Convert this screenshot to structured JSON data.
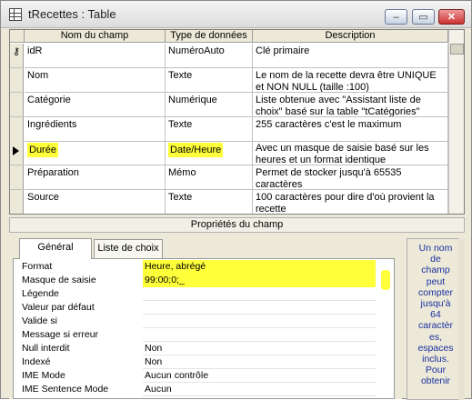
{
  "window": {
    "title": "tRecettes : Table",
    "min_label": "–",
    "max_label": "▭",
    "close_label": "✕"
  },
  "grid": {
    "headers": [
      "Nom du champ",
      "Type de données",
      "Description"
    ],
    "rows": [
      {
        "name": "idR",
        "type": "NuméroAuto",
        "desc": "Clé primaire",
        "key": true,
        "current": false,
        "highlight": false
      },
      {
        "name": "Nom",
        "type": "Texte",
        "desc": "Le nom de la recette devra être UNIQUE et NON NULL (taille :100)",
        "key": false,
        "current": false,
        "highlight": false
      },
      {
        "name": "Catégorie",
        "type": "Numérique",
        "desc": "Liste obtenue avec \"Assistant liste de choix\" basé sur la table \"tCatégories\"",
        "key": false,
        "current": false,
        "highlight": false
      },
      {
        "name": "Ingrédients",
        "type": "Texte",
        "desc": "255 caractères c'est le maximum",
        "key": false,
        "current": false,
        "highlight": false
      },
      {
        "name": "Durée",
        "type": "Date/Heure",
        "desc": "Avec un masque de saisie basé sur les heures et un format identique",
        "key": false,
        "current": true,
        "highlight": true
      },
      {
        "name": "Préparation",
        "type": "Mémo",
        "desc": "Permet de stocker jusqu'à 65535 caractères",
        "key": false,
        "current": false,
        "highlight": false
      },
      {
        "name": "Source",
        "type": "Texte",
        "desc": "100 caractères pour dire d'où provient la recette",
        "key": false,
        "current": false,
        "highlight": false
      }
    ]
  },
  "properties_bar": "Propriétés du champ",
  "tabs": [
    "Général",
    "Liste de choix"
  ],
  "properties": [
    {
      "label": "Format",
      "value": "Heure, abrégé",
      "highlight": true
    },
    {
      "label": "Masque de saisie",
      "value": "99:00;0;_",
      "highlight": true
    },
    {
      "label": "Légende",
      "value": "",
      "highlight": false
    },
    {
      "label": "Valeur par défaut",
      "value": "",
      "highlight": false
    },
    {
      "label": "Valide si",
      "value": "",
      "highlight": false
    },
    {
      "label": "Message si erreur",
      "value": "",
      "highlight": false
    },
    {
      "label": "Null interdit",
      "value": "Non",
      "highlight": false
    },
    {
      "label": "Indexé",
      "value": "Non",
      "highlight": false
    },
    {
      "label": "IME Mode",
      "value": "Aucun contrôle",
      "highlight": false
    },
    {
      "label": "IME Sentence Mode",
      "value": "Aucun",
      "highlight": false
    }
  ],
  "help_lines": [
    "Un nom",
    "de",
    "champ",
    "peut",
    "compter",
    "jusqu'à",
    "64",
    "caractèr",
    "es,",
    "espaces",
    "inclus.",
    "Pour",
    "obtenir"
  ],
  "colors": {
    "highlight": "#ffff3a",
    "help_text": "#1b2fa0"
  },
  "icons": {
    "key": "key-icon",
    "current_row": "row-pointer-icon",
    "table": "table-icon"
  }
}
